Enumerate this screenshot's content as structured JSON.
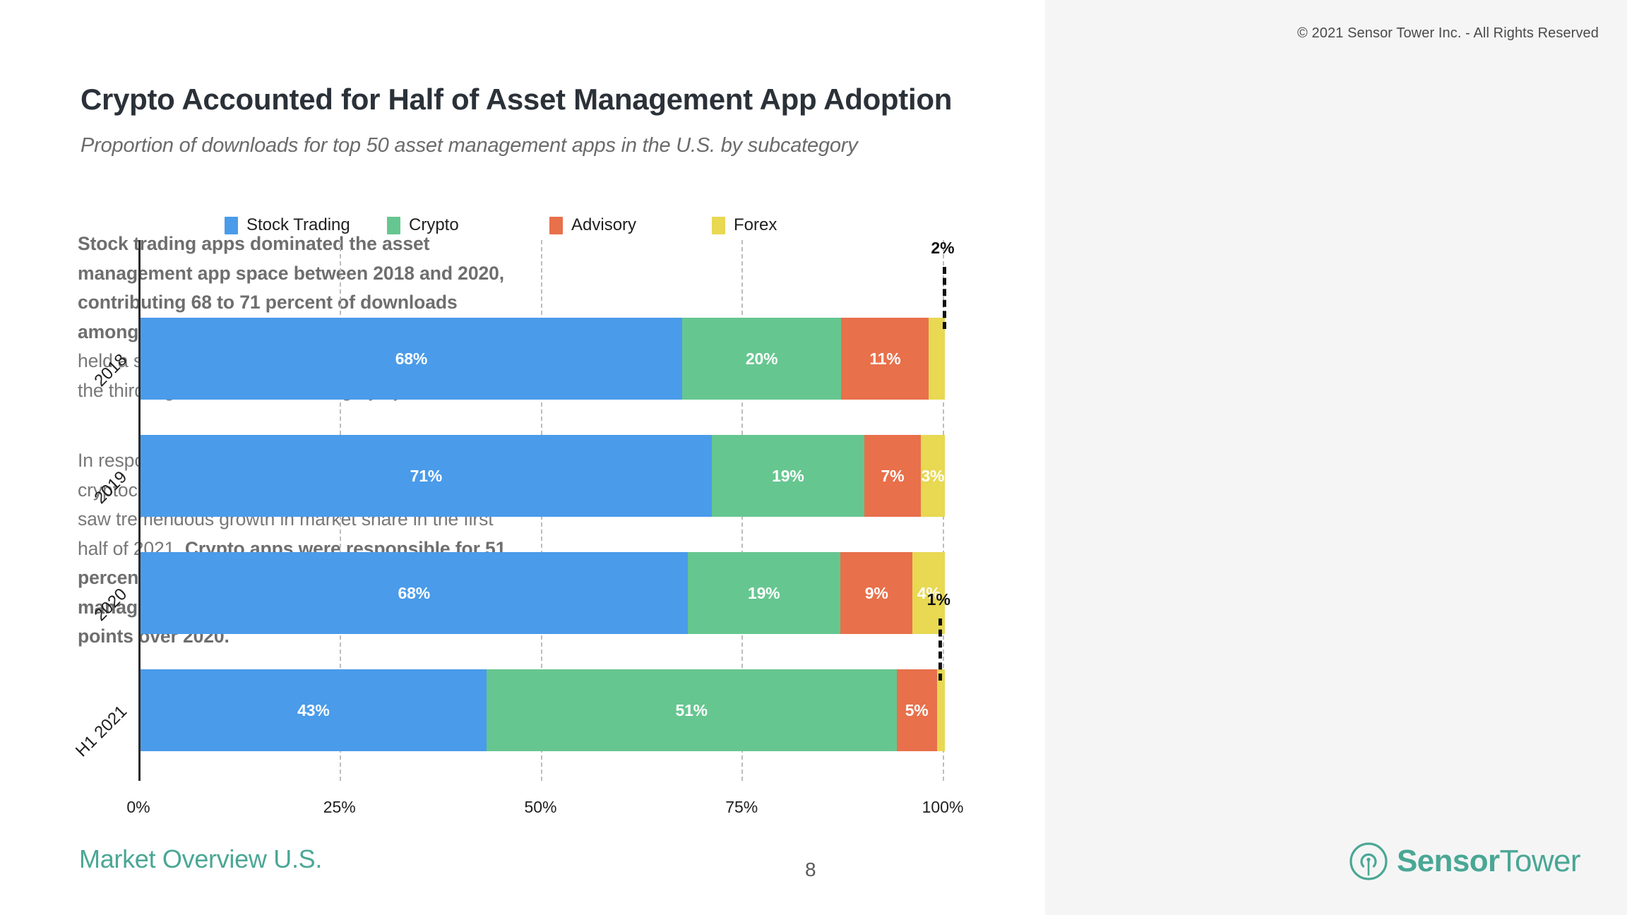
{
  "header": {
    "title": "Crypto Accounted for Half of Asset Management App Adoption",
    "subtitle": "Proportion of downloads for top 50 asset management apps in the U.S. by subcategory"
  },
  "copyright": "© 2021 Sensor Tower Inc. - All Rights Reserved",
  "footer": {
    "section_label": "Market Overview U.S.",
    "page_number": "8"
  },
  "logo": {
    "icon": "sensor-tower-antenna-icon",
    "name_bold": "Sensor",
    "name_regular": "Tower",
    "color": "#4aa795"
  },
  "commentary": {
    "paragraph_1": {
      "bold_lead": "Stock trading apps dominated the asset management app space between 2018 and 2020, contributing 68 to 71 percent of downloads among top asset management apps.",
      "rest": " Crypto apps held a stable share of 20 percent and advisory was the third highest ranked subcategory by share size."
    },
    "paragraph_2": {
      "lead": "In response to the intense interest surrounding cryptocurrency markets in early 2021, crypto apps saw tremendous growth in market share in the first half of 2021. ",
      "bold_rest": "Crypto apps were responsible for 51 percent of the downloads among asset management apps, an increase of 32 percentage points over 2020."
    }
  },
  "chart_data": {
    "type": "bar",
    "orientation": "horizontal",
    "stacked": true,
    "normalized": true,
    "title": "Crypto Accounted for Half of Asset Management App Adoption",
    "subtitle": "Proportion of downloads for top 50 asset management apps in the U.S. by subcategory",
    "xlabel": "",
    "ylabel": "",
    "xlim": [
      0,
      100
    ],
    "grid": true,
    "legend_position": "top",
    "categories": [
      "2018",
      "2019",
      "2020",
      "H1 2021"
    ],
    "xticks": [
      "0%",
      "25%",
      "50%",
      "75%",
      "100%"
    ],
    "xtick_values": [
      0,
      25,
      50,
      75,
      100
    ],
    "series": [
      {
        "name": "Stock Trading",
        "color": "#4a9bea",
        "values": [
          68,
          71,
          68,
          43
        ],
        "labels": [
          "68%",
          "71%",
          "68%",
          "43%"
        ]
      },
      {
        "name": "Crypto",
        "color": "#66c690",
        "values": [
          20,
          19,
          19,
          51
        ],
        "labels": [
          "20%",
          "19%",
          "19%",
          "51%"
        ]
      },
      {
        "name": "Advisory",
        "color": "#e8704b",
        "values": [
          11,
          7,
          9,
          5
        ],
        "labels": [
          "11%",
          "7%",
          "9%",
          "5%"
        ]
      },
      {
        "name": "Forex",
        "color": "#e8d852",
        "values": [
          2,
          3,
          4,
          1
        ],
        "labels": [
          "2%",
          "3%",
          "4%",
          "1%"
        ]
      }
    ],
    "callouts": [
      {
        "category": "2018",
        "series": "Forex",
        "label": "2%"
      },
      {
        "category": "H1 2021",
        "series": "Forex",
        "label": "1%"
      }
    ]
  }
}
